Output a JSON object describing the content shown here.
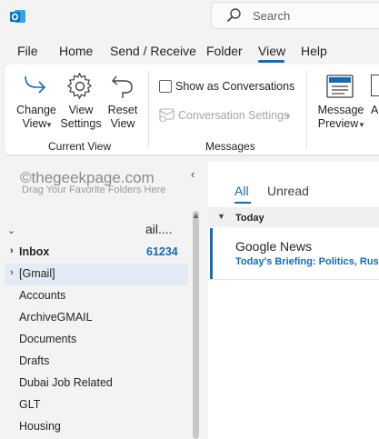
{
  "search": {
    "placeholder": "Search"
  },
  "menu_tabs": [
    {
      "label": "File"
    },
    {
      "label": "Home"
    },
    {
      "label": "Send / Receive"
    },
    {
      "label": "Folder"
    },
    {
      "label": "View"
    },
    {
      "label": "Help"
    }
  ],
  "ribbon": {
    "change_view": {
      "line1": "Change",
      "line2": "View"
    },
    "view_settings": {
      "line1": "View",
      "line2": "Settings"
    },
    "reset_view": {
      "line1": "Reset",
      "line2": "View"
    },
    "current_view_group": "Current View",
    "show_as_conversations": "Show as Conversations",
    "conversation_settings": "Conversation Settings",
    "messages_group": "Messages",
    "message_preview": {
      "line1": "Message",
      "line2": "Preview"
    },
    "cut_label": "A"
  },
  "folder_pane": {
    "watermark": "©thegeekpage.com",
    "drag_hint": "Drag Your Favorite Folders Here",
    "account": "ail....",
    "inbox": {
      "label": "Inbox",
      "count": "61234"
    },
    "gmail": "[Gmail]",
    "folders": [
      "Accounts",
      "ArchiveGMAIL",
      "Documents",
      "Drafts",
      "Dubai Job Related",
      "GLT",
      "Housing"
    ]
  },
  "message_list": {
    "filter_all": "All",
    "filter_unread": "Unread",
    "group_today": "Today",
    "messages": [
      {
        "sender": "Google News",
        "subject": "Today's Briefing: Politics, Russ"
      }
    ]
  },
  "colors": {
    "accent": "#0f6cbd",
    "background": "#f3f3f3",
    "ribbon": "#ffffff"
  }
}
